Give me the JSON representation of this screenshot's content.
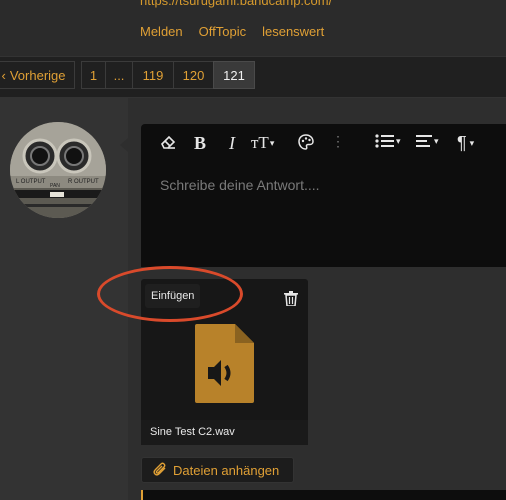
{
  "post": {
    "link_text": "https://tsurugami.bandcamp.com/",
    "links": [
      "Melden",
      "OffTopic",
      "lesenswert"
    ]
  },
  "pagination": {
    "prev_label": "Vorherige",
    "pages": [
      "1",
      "...",
      "119",
      "120",
      "121"
    ],
    "active_page": "121"
  },
  "editor": {
    "placeholder": "Schreibe deine Antwort...."
  },
  "attachment": {
    "insert_label": "Einfügen",
    "filename": "Sine Test C2.wav"
  },
  "actions": {
    "attach_label": "Dateien anhängen"
  },
  "avatar_labels": {
    "left": "L OUTPUT",
    "pan": "PAN",
    "right": "R OUTPUT"
  },
  "colors": {
    "accent": "#e0a035",
    "highlight_circle": "#d94a2b"
  }
}
